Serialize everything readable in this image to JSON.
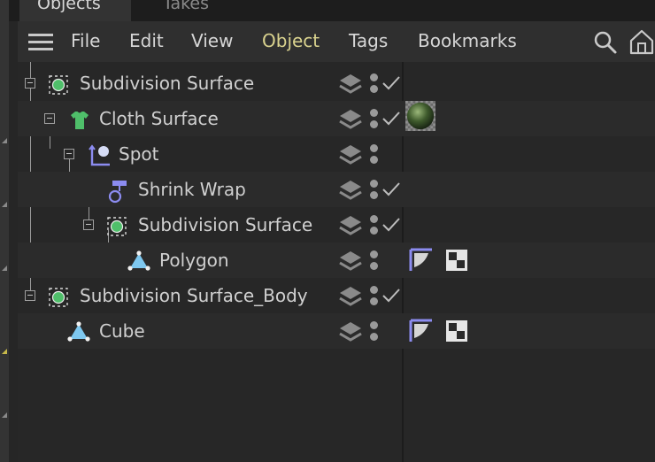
{
  "tabs": [
    {
      "label": "Objects",
      "active": true
    },
    {
      "label": "Takes",
      "active": false
    }
  ],
  "menu": [
    "File",
    "Edit",
    "View",
    "Object",
    "Tags",
    "Bookmarks"
  ],
  "active_menu": "Object",
  "toolbar_icons": [
    "search-icon",
    "home-icon"
  ],
  "colors": {
    "active_menu": "#d9d28e",
    "generator": "#4fbf6a",
    "deformer": "#8c8cf0",
    "polygon": "#7ec8f0"
  },
  "objects": [
    {
      "label": "Subdivision Surface",
      "depth": 0,
      "icon": "subdivision-surface-icon",
      "layer": true,
      "enabled": true,
      "tags": []
    },
    {
      "label": "Cloth Surface",
      "depth": 1,
      "icon": "cloth-surface-icon",
      "layer": true,
      "enabled": true,
      "tags": [
        "material-tag-icon"
      ]
    },
    {
      "label": "Spot",
      "depth": 2,
      "icon": "spot-light-icon",
      "layer": true,
      "enabled": false,
      "tags": []
    },
    {
      "label": "Shrink Wrap",
      "depth": 3,
      "icon": "shrink-wrap-icon",
      "layer": true,
      "enabled": true,
      "tags": []
    },
    {
      "label": "Subdivision Surface",
      "depth": 3,
      "icon": "subdivision-surface-icon",
      "layer": true,
      "enabled": true,
      "tags": []
    },
    {
      "label": "Polygon",
      "depth": 4,
      "icon": "polygon-object-icon",
      "layer": true,
      "enabled": false,
      "tags": [
        "phong-tag-icon",
        "uvw-tag-icon"
      ]
    },
    {
      "label": "Subdivision Surface_Body",
      "depth": 0,
      "icon": "subdivision-surface-icon",
      "layer": true,
      "enabled": true,
      "tags": []
    },
    {
      "label": "Cube",
      "depth": 1,
      "icon": "polygon-object-icon",
      "layer": true,
      "enabled": false,
      "tags": [
        "phong-tag-icon",
        "uvw-tag-icon"
      ]
    }
  ]
}
